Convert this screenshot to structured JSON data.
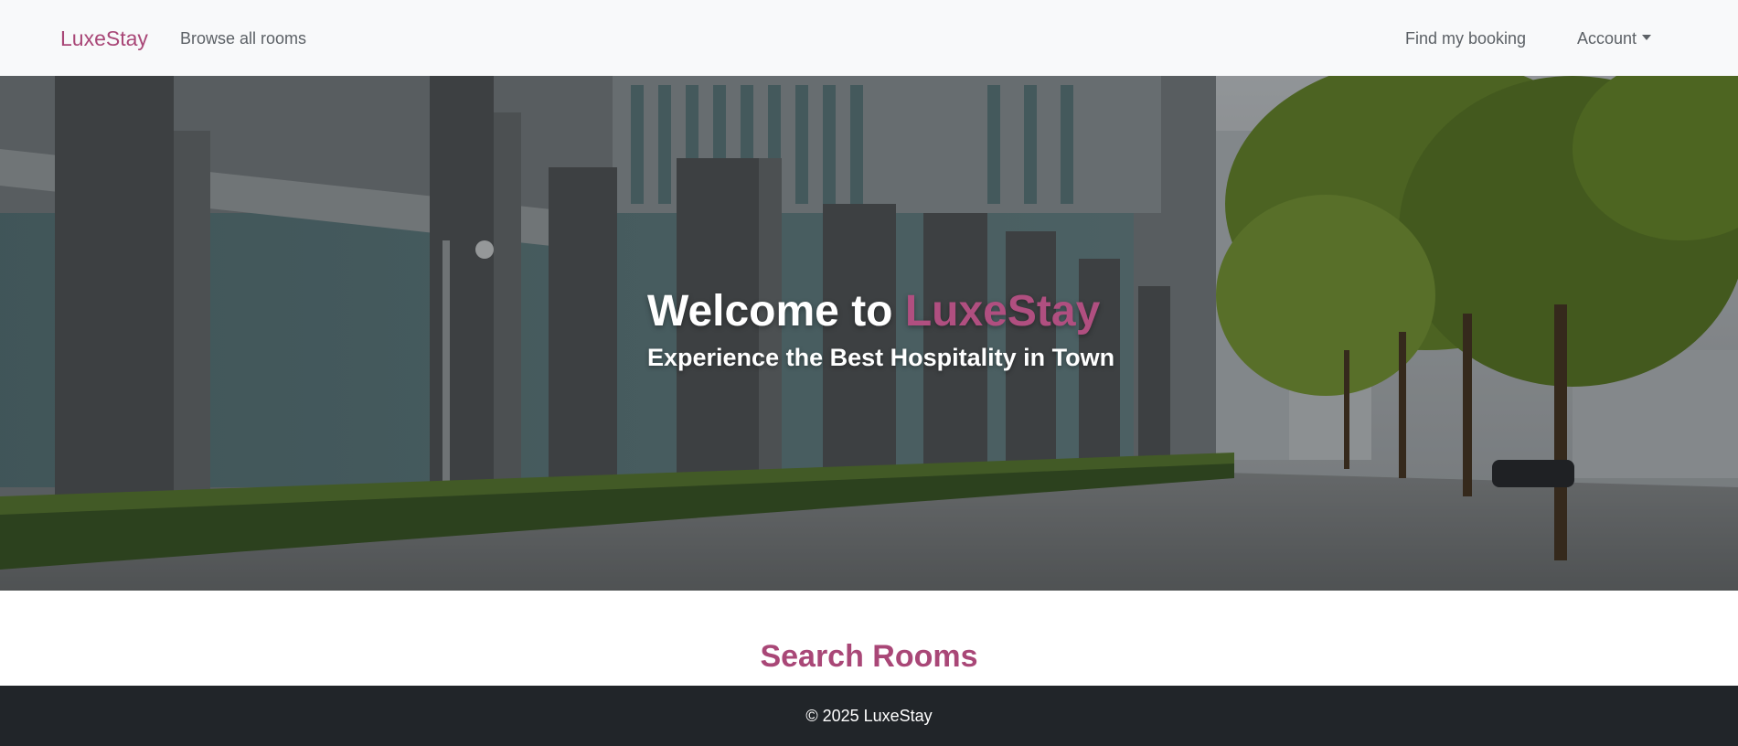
{
  "navbar": {
    "brand": "LuxeStay",
    "browse_label": "Browse all rooms",
    "find_booking_label": "Find my booking",
    "account_label": "Account"
  },
  "hero": {
    "title_prefix": "Welcome to ",
    "title_brand": "LuxeStay",
    "subtitle": "Experience the Best Hospitality in Town"
  },
  "search": {
    "heading": "Search Rooms"
  },
  "footer": {
    "text": "© 2025 LuxeStay"
  },
  "colors": {
    "accent": "#a94777",
    "navbar_bg": "#f8f9fa",
    "footer_bg": "#212529"
  },
  "icons": {
    "account_dropdown": "caret-down-icon"
  }
}
